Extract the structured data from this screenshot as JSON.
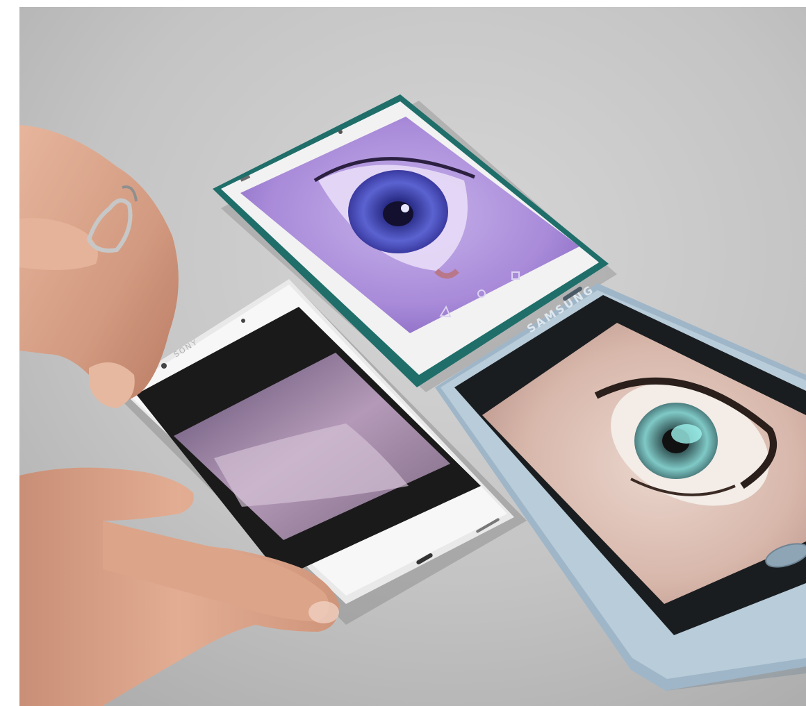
{
  "photo": {
    "brand_texts": {
      "sony": "SONY",
      "samsung": "SAMSUNG"
    },
    "colors": {
      "table": "#bdbdbd",
      "huawei_case": "#1f6e6a",
      "samsung_body": "#9fb6c8",
      "sony_body": "#f2f2f2",
      "skin": "#d9a48a"
    }
  }
}
